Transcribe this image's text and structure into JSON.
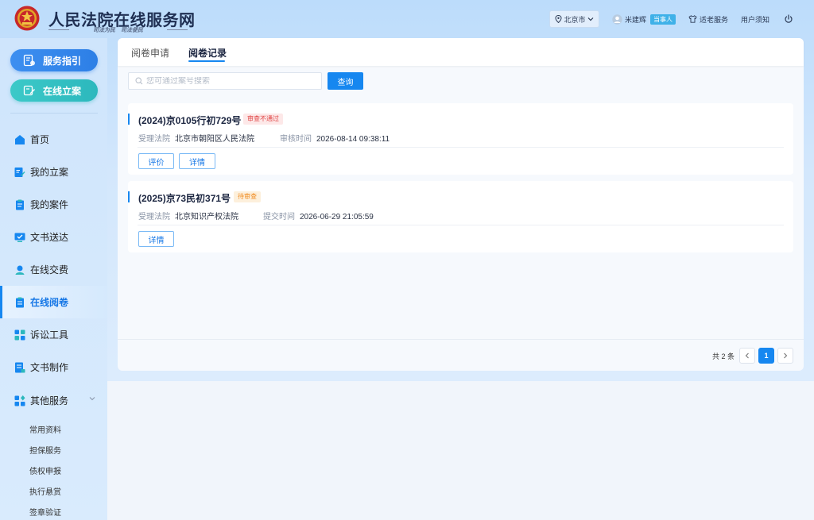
{
  "header": {
    "site_title": "人民法院在线服务网",
    "slogan": "司法为民　司法便民",
    "city": "北京市",
    "user_name": "米建辉",
    "user_role": "当事人",
    "elder_service": "适老服务",
    "user_notice": "用户须知"
  },
  "sidebar": {
    "service_guide": "服务指引",
    "online_filing": "在线立案",
    "items": [
      {
        "label": "首页",
        "icon": "home-icon"
      },
      {
        "label": "我的立案",
        "icon": "edit-document-icon"
      },
      {
        "label": "我的案件",
        "icon": "clipboard-icon"
      },
      {
        "label": "文书送达",
        "icon": "monitor-check-icon"
      },
      {
        "label": "在线交费",
        "icon": "payment-user-icon"
      },
      {
        "label": "在线阅卷",
        "icon": "file-review-icon",
        "active": true
      },
      {
        "label": "诉讼工具",
        "icon": "grid-tools-icon"
      },
      {
        "label": "文书制作",
        "icon": "document-make-icon"
      },
      {
        "label": "其他服务",
        "icon": "more-services-icon"
      }
    ],
    "sub_items": [
      "常用资料",
      "担保服务",
      "债权申报",
      "执行悬赏",
      "签章验证"
    ]
  },
  "tabs": [
    {
      "label": "阅卷申请",
      "active": false
    },
    {
      "label": "阅卷记录",
      "active": true
    }
  ],
  "search": {
    "placeholder": "您可通过案号搜索",
    "value": "",
    "button": "查询"
  },
  "records": [
    {
      "case_no": "(2024)京0105行初729号",
      "status": "审查不通过",
      "status_type": "rejected",
      "court_label": "受理法院",
      "court": "北京市朝阳区人民法院",
      "time_label": "审核时间",
      "time": "2026-08-14 09:38:11",
      "buttons": [
        "评价",
        "详情"
      ]
    },
    {
      "case_no": "(2025)京73民初371号",
      "status": "待审查",
      "status_type": "pending",
      "court_label": "受理法院",
      "court": "北京知识产权法院",
      "time_label": "提交时间",
      "time": "2026-06-29 21:05:59",
      "buttons": [
        "详情"
      ]
    }
  ],
  "pagination": {
    "total": "共 2 条",
    "current_page": "1"
  },
  "colors": {
    "primary": "#1687f0",
    "rejected": "#e04545",
    "pending": "#f08a1e",
    "teal": "#2cb8bd"
  }
}
